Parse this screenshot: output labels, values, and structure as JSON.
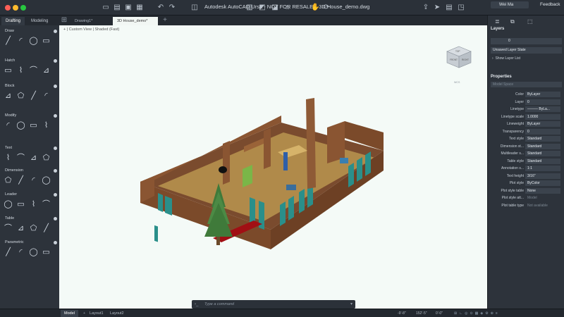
{
  "window": {
    "title": "Autodesk AutoCAD Ursa - NOT FOR RESALE",
    "filename": "3D House_demo.dwg"
  },
  "user": {
    "name": "Wei Ma"
  },
  "feedback_label": "Feedback",
  "left_tabs": [
    "Drafting",
    "Modeling"
  ],
  "doc_tabs": [
    "Drawing1*",
    "3D House_demo*"
  ],
  "tool_sections": [
    "Draw",
    "Hatch",
    "Block",
    "Modify",
    "Text",
    "Dimension",
    "Leader",
    "Table",
    "Parametric"
  ],
  "viewport_label": "+ | Custom View | Shaded (Fast)",
  "viewcube": {
    "faces": [
      "TOP",
      "FRONT",
      "RIGHT"
    ],
    "ucs": "WCS"
  },
  "command_placeholder": "Type a command",
  "layers": {
    "title": "Layers",
    "current": "0",
    "state": "Unsaved Layer State",
    "toggle": "Show Layer List"
  },
  "properties": {
    "title": "Properties",
    "space": "Model Space",
    "rows": [
      {
        "label": "Color",
        "value": "ByLayer"
      },
      {
        "label": "Layer",
        "value": "0"
      },
      {
        "label": "Linetype",
        "value": "——— ByLa..."
      },
      {
        "label": "Linetype scale",
        "value": "1.0000"
      },
      {
        "label": "Lineweight",
        "value": "ByLayer"
      },
      {
        "label": "Transparency",
        "value": "0"
      },
      {
        "label": "Text style",
        "value": "Standard"
      },
      {
        "label": "Dimension st...",
        "value": "Standard"
      },
      {
        "label": "Multileader s...",
        "value": "Standard"
      },
      {
        "label": "Table style",
        "value": "Standard"
      },
      {
        "label": "Annotation s...",
        "value": "1:1"
      },
      {
        "label": "Text height",
        "value": "3/16\""
      },
      {
        "label": "Plot style",
        "value": "ByColor"
      },
      {
        "label": "Plot style table",
        "value": "None"
      },
      {
        "label": "Plot style att...",
        "value": "Model",
        "dim": true
      },
      {
        "label": "Plot table type",
        "value": "Not available",
        "dim": true
      }
    ]
  },
  "layout_tabs": [
    "Model",
    "Layout1",
    "Layout2"
  ],
  "status": {
    "coords_x": "-9'-8\"",
    "coords_y": "152'-5\"",
    "coords_z": "0'-0\""
  },
  "colors": {
    "accent": "#2f80ed",
    "canvas": "#f4faf7",
    "panel": "#2d333b"
  }
}
